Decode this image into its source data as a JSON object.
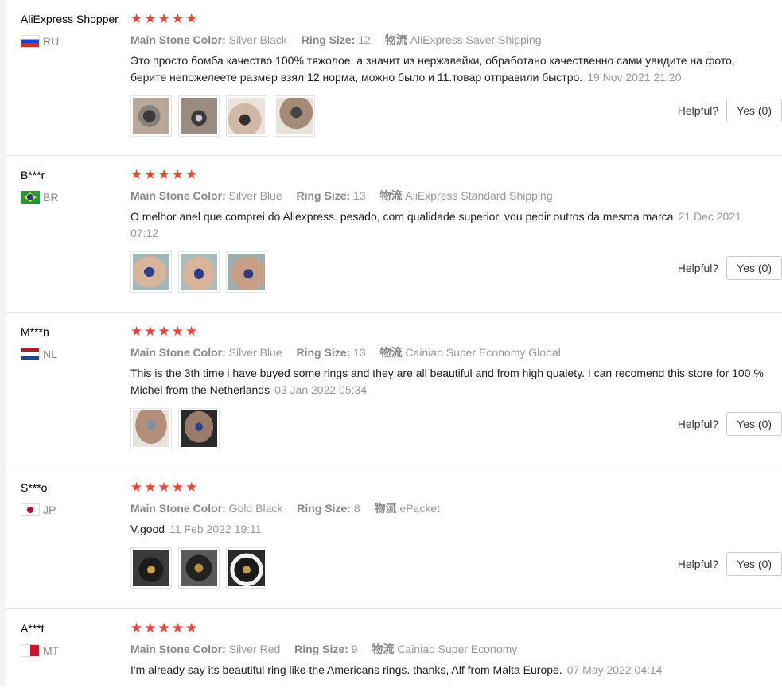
{
  "reviews": [
    {
      "user": "AliExpress Shopper",
      "country": "RU",
      "flag": "ru",
      "rating": 5,
      "attrs": [
        {
          "key": "Main Stone Color:",
          "value": "Silver Black"
        },
        {
          "key": "Ring Size:",
          "value": "12"
        },
        {
          "key": "物流",
          "value": "AliExpress Saver Shipping"
        }
      ],
      "text": "Это просто бомба качество 100% тяжолое, а значит из нержавейки, обработано качественно сами увидите на фото, берите непожелеете размер взял 12 норма, можно было и 11.товар отправили быстро.",
      "date": "19 Nov 2021 21:20",
      "photo_count": 4,
      "helpful_label": "Helpful?",
      "yes_label": "Yes (0)"
    },
    {
      "user": "B***r",
      "country": "BR",
      "flag": "br",
      "rating": 5,
      "attrs": [
        {
          "key": "Main Stone Color:",
          "value": "Silver Blue"
        },
        {
          "key": "Ring Size:",
          "value": "13"
        },
        {
          "key": "物流",
          "value": "AliExpress Standard Shipping"
        }
      ],
      "text": "O melhor anel que comprei do Aliexpress. pesado, com qualidade superior. vou pedir outros da mesma marca",
      "date": "21 Dec 2021 07:12",
      "photo_count": 3,
      "helpful_label": "Helpful?",
      "yes_label": "Yes (0)"
    },
    {
      "user": "M***n",
      "country": "NL",
      "flag": "nl",
      "rating": 5,
      "attrs": [
        {
          "key": "Main Stone Color:",
          "value": "Silver Blue"
        },
        {
          "key": "Ring Size:",
          "value": "13"
        },
        {
          "key": "物流",
          "value": "Cainiao Super Economy Global"
        }
      ],
      "text": "This is the 3th time i have buyed some rings and they are all beautiful and from high qualety. I can recomend this store for 100 % Michel from the Netherlands",
      "date": "03 Jan 2022 05:34",
      "photo_count": 2,
      "helpful_label": "Helpful?",
      "yes_label": "Yes (0)"
    },
    {
      "user": "S***o",
      "country": "JP",
      "flag": "jp",
      "rating": 5,
      "attrs": [
        {
          "key": "Main Stone Color:",
          "value": "Gold Black"
        },
        {
          "key": "Ring Size:",
          "value": "8"
        },
        {
          "key": "物流",
          "value": "ePacket"
        }
      ],
      "text": "V.good",
      "date": "11 Feb 2022 19:11",
      "photo_count": 3,
      "helpful_label": "Helpful?",
      "yes_label": "Yes (0)"
    },
    {
      "user": "A***t",
      "country": "MT",
      "flag": "mt",
      "rating": 5,
      "attrs": [
        {
          "key": "Main Stone Color:",
          "value": "Silver Red"
        },
        {
          "key": "Ring Size:",
          "value": "9"
        },
        {
          "key": "物流",
          "value": "Cainiao Super Economy"
        }
      ],
      "text": "I'm already say its beautiful ring like the Americans rings. thanks, Alf from Malta Europe.",
      "date": "07 May 2022 04:14",
      "photo_count": 0,
      "helpful_label": "",
      "yes_label": ""
    }
  ],
  "colors": {
    "star": "#f44336",
    "muted": "#888888"
  }
}
